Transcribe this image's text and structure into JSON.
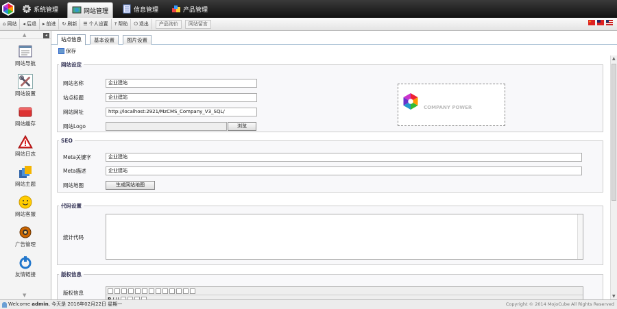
{
  "top_tabs": [
    {
      "label": "系统管理",
      "icon": "gear-icon"
    },
    {
      "label": "网站管理",
      "icon": "globe-icon"
    },
    {
      "label": "信息管理",
      "icon": "document-icon"
    },
    {
      "label": "产品管理",
      "icon": "products-icon"
    }
  ],
  "toolbar": {
    "items": [
      "网站",
      "后退",
      "前进",
      "刷新",
      "个人设置",
      "帮助",
      "退出"
    ],
    "links": [
      "产品询价",
      "网站留言"
    ]
  },
  "sidebar": {
    "items": [
      {
        "label": "网站导航",
        "icon": "navigation-icon"
      },
      {
        "label": "网站设置",
        "icon": "tools-icon"
      },
      {
        "label": "网站缓存",
        "icon": "cache-icon"
      },
      {
        "label": "网站日志",
        "icon": "warning-icon"
      },
      {
        "label": "网站主题",
        "icon": "theme-icon"
      },
      {
        "label": "网站客服",
        "icon": "support-icon"
      },
      {
        "label": "广告管理",
        "icon": "megaphone-icon"
      },
      {
        "label": "友情链接",
        "icon": "link-icon"
      }
    ]
  },
  "sub_tabs": [
    "站点信息",
    "基本设置",
    "图片设置"
  ],
  "save_label": "保存",
  "site_settings": {
    "legend": "网站设定",
    "site_name_label": "网站名称",
    "site_name_value": "企业建站",
    "site_title_label": "站点标题",
    "site_title_value": "企业建站",
    "site_url_label": "网站网址",
    "site_url_value": "http://localhost:2921/MzCMS_Company_V3_SQL/",
    "logo_label": "网站Logo",
    "browse_label": "浏览",
    "logo_text": "COMPANY POWER"
  },
  "seo": {
    "legend": "SEO",
    "keywords_label": "Meta关键字",
    "keywords_value": "企业建站",
    "description_label": "Meta描述",
    "description_value": "企业建站",
    "sitemap_label": "网站地图",
    "sitemap_button": "生成网站地图"
  },
  "code": {
    "legend": "代码设置",
    "stats_label": "统计代码"
  },
  "copyright": {
    "legend": "版权信息",
    "label": "版权信息"
  },
  "status": {
    "welcome_prefix": "Welcome",
    "user": "admin",
    "date_text": ", 今天是 2016年02月22日 星期一",
    "copyright": "Copyright © 2014 MojoCube All Rights Reserved"
  }
}
